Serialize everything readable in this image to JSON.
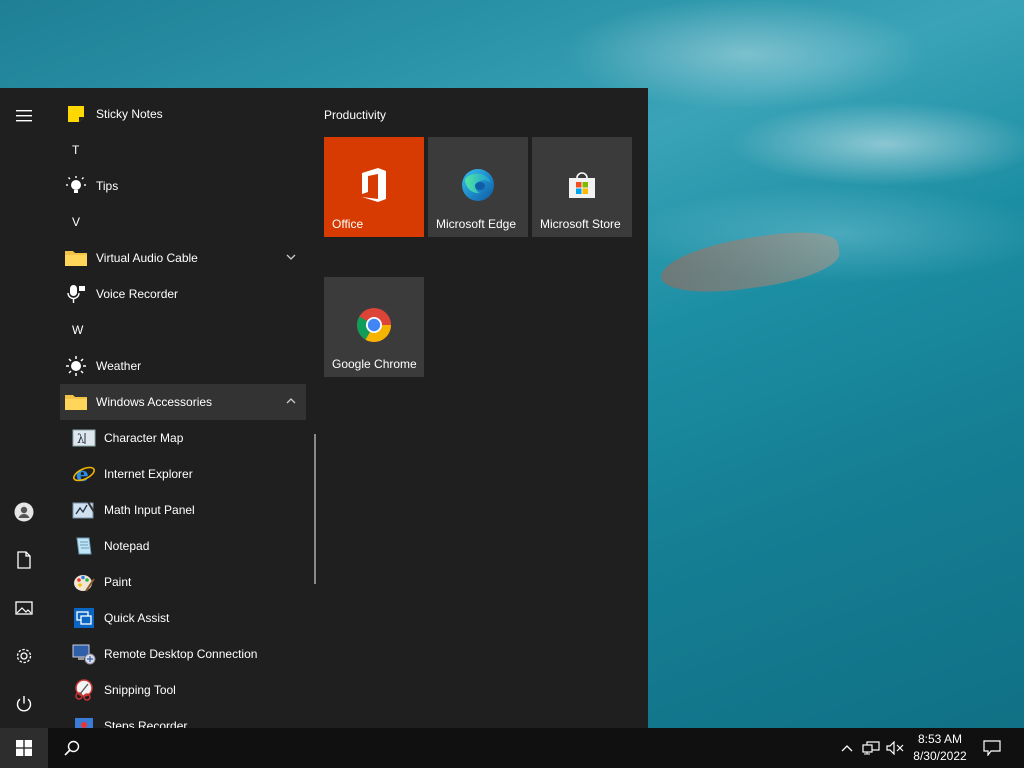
{
  "start_menu": {
    "app_list": {
      "items": [
        {
          "type": "app",
          "label": "Sticky Notes",
          "icon": "sticky-notes-icon"
        },
        {
          "type": "letter",
          "label": "T"
        },
        {
          "type": "app",
          "label": "Tips",
          "icon": "tips-icon"
        },
        {
          "type": "letter",
          "label": "V"
        },
        {
          "type": "folder",
          "label": "Virtual Audio Cable",
          "icon": "folder-icon",
          "expanded": false
        },
        {
          "type": "app",
          "label": "Voice Recorder",
          "icon": "voice-recorder-icon"
        },
        {
          "type": "letter",
          "label": "W"
        },
        {
          "type": "app",
          "label": "Weather",
          "icon": "weather-icon"
        },
        {
          "type": "folder",
          "label": "Windows Accessories",
          "icon": "folder-icon",
          "expanded": true
        },
        {
          "type": "sub",
          "label": "Character Map",
          "icon": "character-map-icon"
        },
        {
          "type": "sub",
          "label": "Internet Explorer",
          "icon": "internet-explorer-icon"
        },
        {
          "type": "sub",
          "label": "Math Input Panel",
          "icon": "math-input-panel-icon"
        },
        {
          "type": "sub",
          "label": "Notepad",
          "icon": "notepad-icon"
        },
        {
          "type": "sub",
          "label": "Paint",
          "icon": "paint-icon"
        },
        {
          "type": "sub",
          "label": "Quick Assist",
          "icon": "quick-assist-icon"
        },
        {
          "type": "sub",
          "label": "Remote Desktop Connection",
          "icon": "remote-desktop-icon"
        },
        {
          "type": "sub",
          "label": "Snipping Tool",
          "icon": "snipping-tool-icon"
        },
        {
          "type": "sub",
          "label": "Steps Recorder",
          "icon": "steps-recorder-icon"
        }
      ]
    },
    "tiles": {
      "group_title": "Productivity",
      "items": [
        {
          "label": "Office",
          "icon": "office-icon",
          "color": "#d83b01"
        },
        {
          "label": "Microsoft Edge",
          "icon": "edge-icon",
          "color": "#3b3b3b"
        },
        {
          "label": "Microsoft Store",
          "icon": "store-icon",
          "color": "#3b3b3b"
        },
        {
          "label": "Google Chrome",
          "icon": "chrome-icon",
          "color": "#3b3b3b"
        }
      ]
    },
    "rail": [
      "hamburger-menu-icon",
      "user-icon",
      "documents-icon",
      "pictures-icon",
      "settings-icon",
      "power-icon"
    ]
  },
  "taskbar": {
    "time": "8:53 AM",
    "date": "8/30/2022",
    "tray_icons": [
      "chevron-up-icon",
      "network-icon",
      "volume-muted-icon",
      "notifications-icon"
    ]
  },
  "colors": {
    "menu_bg": "#1f1f1f",
    "taskbar_bg": "#101010",
    "office_tile": "#d83b01",
    "tile_bg": "#3b3b3b"
  }
}
